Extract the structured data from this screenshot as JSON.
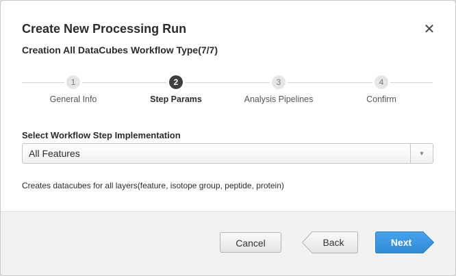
{
  "dialog": {
    "title": "Create New Processing Run",
    "subtitle": "Creation All DataCubes Workflow Type(7/7)",
    "close_icon": "close-icon"
  },
  "stepper": {
    "steps": [
      {
        "number": "1",
        "label": "General Info",
        "active": false
      },
      {
        "number": "2",
        "label": "Step Params",
        "active": true
      },
      {
        "number": "3",
        "label": "Analysis Pipelines",
        "active": false
      },
      {
        "number": "4",
        "label": "Confirm",
        "active": false
      }
    ]
  },
  "form": {
    "label": "Select Workflow Step Implementation",
    "selected_value": "All Features",
    "dropdown_icon": "chevron-down-icon",
    "description": "Creates datacubes for all layers(feature, isotope group, peptide, protein)"
  },
  "footer": {
    "cancel_label": "Cancel",
    "back_label": "Back",
    "next_label": "Next"
  },
  "colors": {
    "accent": "#3a96e0",
    "active_step": "#3f3f3f"
  }
}
